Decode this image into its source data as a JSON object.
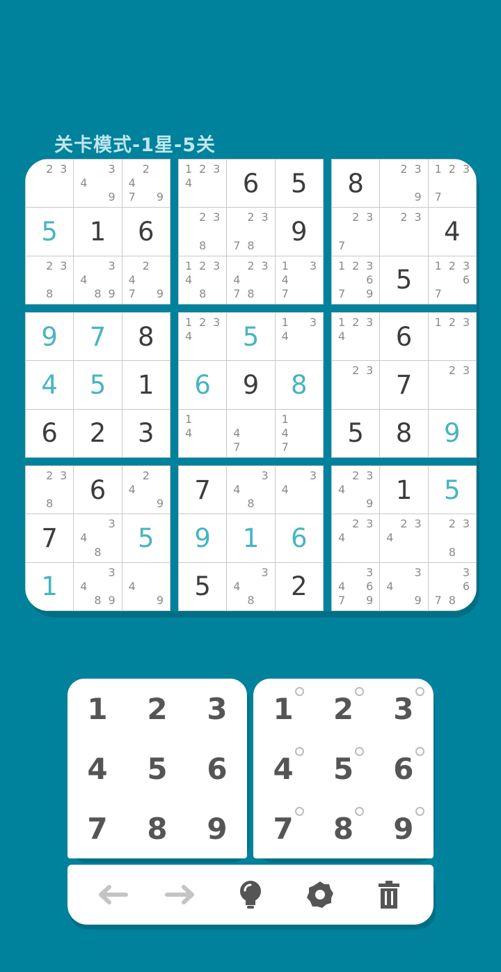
{
  "header": {
    "title": "关卡模式-1星-5关"
  },
  "board": {
    "rows": [
      [
        {
          "n": [
            null,
            "2",
            "3",
            null,
            null,
            null,
            null,
            null,
            null
          ]
        },
        {
          "n": [
            null,
            null,
            "3",
            "4",
            null,
            null,
            null,
            null,
            "9"
          ]
        },
        {
          "n": [
            null,
            "2",
            null,
            "4",
            null,
            null,
            "7",
            null,
            "9"
          ]
        },
        {
          "n": [
            "1",
            "2",
            "3",
            "4",
            null,
            null,
            null,
            null,
            null
          ]
        },
        {
          "v": "6",
          "t": "given"
        },
        {
          "v": "5",
          "t": "given"
        },
        {
          "v": "8",
          "t": "given"
        },
        {
          "n": [
            null,
            "2",
            "3",
            null,
            null,
            null,
            null,
            null,
            "9"
          ]
        },
        {
          "n": [
            "1",
            "2",
            "3",
            null,
            null,
            null,
            "7",
            null,
            null
          ]
        }
      ],
      [
        {
          "v": "5",
          "t": "user"
        },
        {
          "v": "1",
          "t": "given"
        },
        {
          "v": "6",
          "t": "given"
        },
        {
          "n": [
            null,
            "2",
            "3",
            null,
            null,
            null,
            null,
            "8",
            null
          ]
        },
        {
          "n": [
            null,
            "2",
            "3",
            null,
            null,
            null,
            "7",
            "8",
            null
          ]
        },
        {
          "v": "9",
          "t": "given"
        },
        {
          "n": [
            null,
            "2",
            "3",
            null,
            null,
            null,
            "7",
            null,
            null
          ]
        },
        {
          "n": [
            null,
            "2",
            "3",
            null,
            null,
            null,
            null,
            null,
            null
          ]
        },
        {
          "v": "4",
          "t": "given"
        }
      ],
      [
        {
          "n": [
            null,
            "2",
            "3",
            null,
            null,
            null,
            null,
            "8",
            null
          ]
        },
        {
          "n": [
            null,
            null,
            "3",
            "4",
            null,
            null,
            null,
            "8",
            "9"
          ]
        },
        {
          "n": [
            null,
            "2",
            null,
            "4",
            null,
            null,
            "7",
            null,
            "9"
          ]
        },
        {
          "n": [
            "1",
            "2",
            "3",
            "4",
            null,
            null,
            null,
            "8",
            null
          ]
        },
        {
          "n": [
            null,
            "2",
            "3",
            "4",
            null,
            null,
            "7",
            "8",
            null
          ]
        },
        {
          "n": [
            "1",
            null,
            "3",
            "4",
            null,
            null,
            "7",
            null,
            null
          ]
        },
        {
          "n": [
            "1",
            "2",
            "3",
            null,
            null,
            "6",
            "7",
            null,
            "9"
          ]
        },
        {
          "v": "5",
          "t": "given"
        },
        {
          "n": [
            "1",
            "2",
            "3",
            null,
            null,
            "6",
            "7",
            null,
            null
          ]
        }
      ],
      [
        {
          "v": "9",
          "t": "user"
        },
        {
          "v": "7",
          "t": "user"
        },
        {
          "v": "8",
          "t": "given"
        },
        {
          "n": [
            "1",
            "2",
            "3",
            "4",
            null,
            null,
            null,
            null,
            null
          ]
        },
        {
          "v": "5",
          "t": "user"
        },
        {
          "n": [
            "1",
            null,
            "3",
            "4",
            null,
            null,
            null,
            null,
            null
          ]
        },
        {
          "n": [
            "1",
            "2",
            "3",
            "4",
            null,
            null,
            null,
            null,
            null
          ]
        },
        {
          "v": "6",
          "t": "given"
        },
        {
          "n": [
            "1",
            "2",
            "3",
            null,
            null,
            null,
            null,
            null,
            null
          ]
        }
      ],
      [
        {
          "v": "4",
          "t": "user"
        },
        {
          "v": "5",
          "t": "user"
        },
        {
          "v": "1",
          "t": "given"
        },
        {
          "v": "6",
          "t": "user"
        },
        {
          "v": "9",
          "t": "given"
        },
        {
          "v": "8",
          "t": "user"
        },
        {
          "n": [
            null,
            "2",
            "3",
            null,
            null,
            null,
            null,
            null,
            null
          ]
        },
        {
          "v": "7",
          "t": "given"
        },
        {
          "n": [
            null,
            "2",
            "3",
            null,
            null,
            null,
            null,
            null,
            null
          ]
        }
      ],
      [
        {
          "v": "6",
          "t": "given"
        },
        {
          "v": "2",
          "t": "given"
        },
        {
          "v": "3",
          "t": "given"
        },
        {
          "n": [
            "1",
            null,
            null,
            "4",
            null,
            null,
            null,
            null,
            null
          ]
        },
        {
          "n": [
            null,
            null,
            null,
            "4",
            null,
            null,
            "7",
            null,
            null
          ]
        },
        {
          "n": [
            "1",
            null,
            null,
            "4",
            null,
            null,
            "7",
            null,
            null
          ]
        },
        {
          "v": "5",
          "t": "given"
        },
        {
          "v": "8",
          "t": "given"
        },
        {
          "v": "9",
          "t": "user"
        }
      ],
      [
        {
          "n": [
            null,
            "2",
            "3",
            null,
            null,
            null,
            null,
            "8",
            null
          ]
        },
        {
          "v": "6",
          "t": "given"
        },
        {
          "n": [
            null,
            "2",
            null,
            "4",
            null,
            null,
            null,
            null,
            "9"
          ]
        },
        {
          "v": "7",
          "t": "given"
        },
        {
          "n": [
            null,
            null,
            "3",
            "4",
            null,
            null,
            null,
            "8",
            null
          ]
        },
        {
          "n": [
            null,
            null,
            "3",
            "4",
            null,
            null,
            null,
            null,
            null
          ]
        },
        {
          "n": [
            null,
            "2",
            "3",
            "4",
            null,
            null,
            null,
            null,
            "9"
          ]
        },
        {
          "v": "1",
          "t": "given"
        },
        {
          "v": "5",
          "t": "user"
        }
      ],
      [
        {
          "v": "7",
          "t": "given"
        },
        {
          "n": [
            null,
            null,
            "3",
            "4",
            null,
            null,
            null,
            "8",
            null
          ]
        },
        {
          "v": "5",
          "t": "user"
        },
        {
          "v": "9",
          "t": "user"
        },
        {
          "v": "1",
          "t": "user"
        },
        {
          "v": "6",
          "t": "user"
        },
        {
          "n": [
            null,
            "2",
            "3",
            "4",
            null,
            null,
            null,
            null,
            null
          ]
        },
        {
          "n": [
            null,
            "2",
            "3",
            "4",
            null,
            null,
            null,
            null,
            null
          ]
        },
        {
          "n": [
            null,
            "2",
            "3",
            null,
            null,
            null,
            null,
            "8",
            null
          ]
        }
      ],
      [
        {
          "v": "1",
          "t": "user"
        },
        {
          "n": [
            null,
            null,
            "3",
            "4",
            null,
            null,
            null,
            "8",
            "9"
          ]
        },
        {
          "n": [
            null,
            null,
            null,
            "4",
            null,
            null,
            null,
            null,
            "9"
          ]
        },
        {
          "v": "5",
          "t": "given"
        },
        {
          "n": [
            null,
            null,
            "3",
            "4",
            null,
            null,
            null,
            "8",
            null
          ]
        },
        {
          "v": "2",
          "t": "given"
        },
        {
          "n": [
            null,
            null,
            "3",
            "4",
            null,
            "6",
            "7",
            null,
            "9"
          ]
        },
        {
          "n": [
            null,
            null,
            "3",
            "4",
            null,
            null,
            null,
            null,
            "9"
          ]
        },
        {
          "n": [
            null,
            null,
            "3",
            null,
            null,
            "6",
            "7",
            "8",
            null
          ]
        }
      ]
    ]
  },
  "keypad": {
    "numbers": [
      "1",
      "2",
      "3",
      "4",
      "5",
      "6",
      "7",
      "8",
      "9"
    ],
    "notes": [
      "1",
      "2",
      "3",
      "4",
      "5",
      "6",
      "7",
      "8",
      "9"
    ]
  },
  "toolbar": {
    "icons": [
      "arrow-left-icon",
      "arrow-right-icon",
      "lightbulb-icon",
      "gear-icon",
      "trash-icon"
    ],
    "colors": {
      "disabled": "#c4c4c4",
      "active": "#555555"
    }
  },
  "colors": {
    "background": "#00819c",
    "given": "#3c3c3c",
    "user": "#47b4c2"
  }
}
